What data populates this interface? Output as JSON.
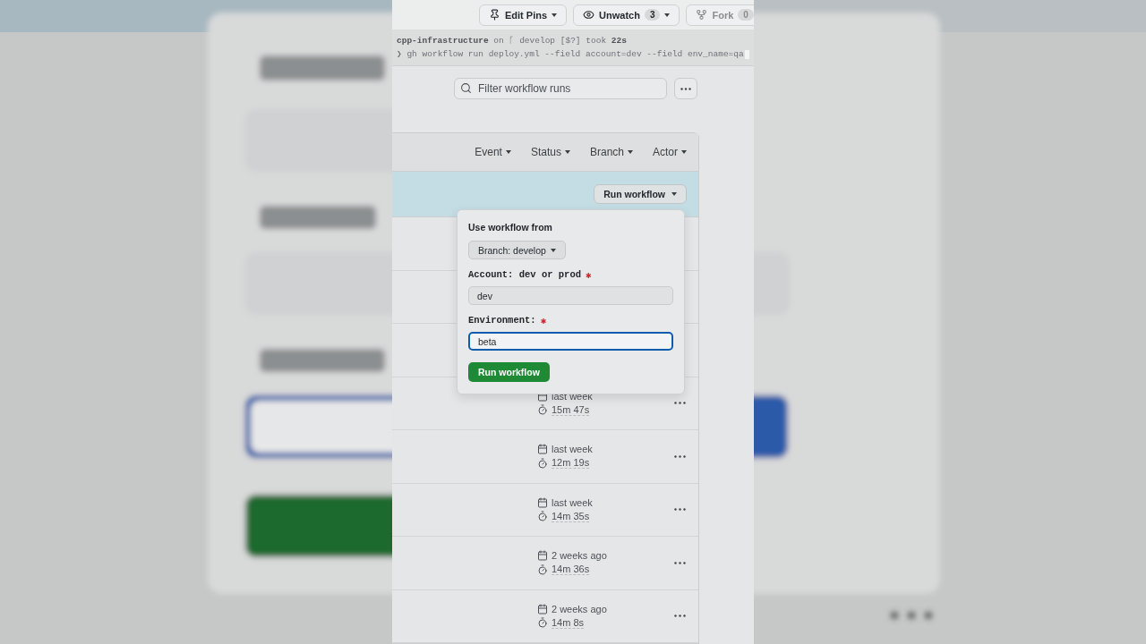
{
  "header_buttons": [
    {
      "kind": "pins",
      "label": "Edit Pins",
      "dropdown": true,
      "disabled": false
    },
    {
      "kind": "watch",
      "label": "Unwatch",
      "count": "3",
      "dropdown": true,
      "disabled": false
    },
    {
      "kind": "fork",
      "label": "Fork",
      "count": "0",
      "dropdown": false,
      "disabled": true
    }
  ],
  "terminal": {
    "prompt": {
      "dir": "cpp-infrastructure",
      "on": "on",
      "branch_icon": "ᚴ",
      "branch": "develop",
      "status": "[$?]",
      "took": "took",
      "duration": "22s"
    },
    "command": "❯ gh workflow run deploy.yml --field account=dev --field env_name=qa"
  },
  "filter": {
    "placeholder": "Filter workflow runs"
  },
  "table_filters": [
    "Event",
    "Status",
    "Branch",
    "Actor"
  ],
  "run_workflow_button": "Run workflow",
  "popover": {
    "title": "Use workflow from",
    "branch_button": "Branch: develop",
    "fields": [
      {
        "label": "Account: dev or prod",
        "required_mark": "✱",
        "value": "dev",
        "focused": false
      },
      {
        "label": "Environment:",
        "required_mark": "✱",
        "value": "beta",
        "focused": true
      }
    ],
    "submit": "Run workflow"
  },
  "runs": [
    {
      "when": "last week",
      "duration": "15m 47s"
    },
    {
      "when": "last week",
      "duration": "12m 19s"
    },
    {
      "when": "last week",
      "duration": "14m 35s"
    },
    {
      "when": "2 weeks ago",
      "duration": "14m 36s"
    },
    {
      "when": "2 weeks ago",
      "duration": "14m 8s"
    }
  ]
}
